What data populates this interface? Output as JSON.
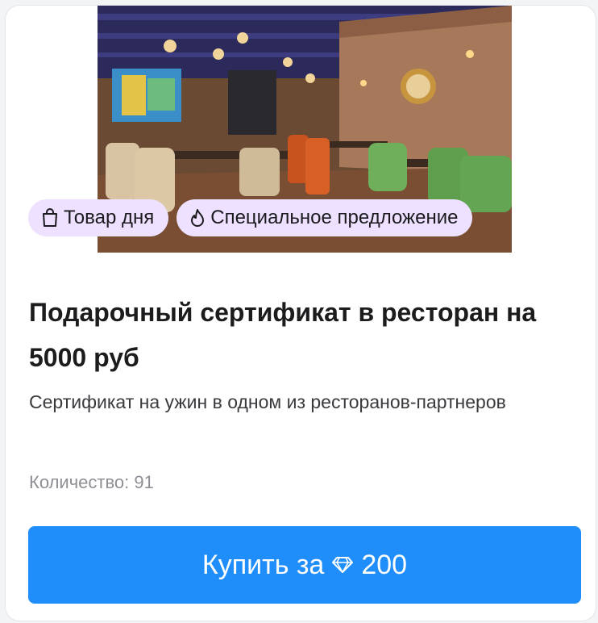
{
  "product": {
    "image_alt": "Restaurant interior",
    "badges": [
      {
        "icon": "shopping-bag-icon",
        "label": "Товар дня"
      },
      {
        "icon": "flame-icon",
        "label": "Специальное предложение"
      }
    ],
    "title": "Подарочный сертификат в ресторан на 5000 руб",
    "description": "Сертификат на ужин в одном из ресторанов-партнеров",
    "quantity_label": "Количество: 91",
    "buy_label": "Купить за",
    "price_icon": "diamond-icon",
    "price": "200"
  },
  "colors": {
    "badge_bg": "#ede1ff",
    "button_bg": "#1f8efa",
    "muted_text": "#8d8f94"
  }
}
